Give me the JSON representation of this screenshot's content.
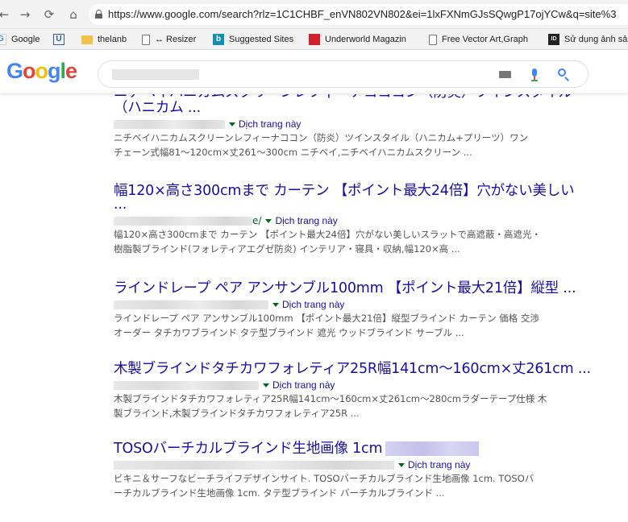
{
  "browser": {
    "url": "https://www.google.com/search?rlz=1C1CHBF_enVN802VN802&ei=1lxFXNmGJsSQwgP17ojYCw&q=site%3",
    "bookmarks": [
      {
        "label": "Google",
        "icon": "google-icon"
      },
      {
        "label": "",
        "icon": "u-icon"
      },
      {
        "label": "thelanb",
        "icon": "folder-icon"
      },
      {
        "label": "↔ Resizer",
        "icon": "page-icon"
      },
      {
        "label": "Suggested Sites",
        "icon": "bing-icon"
      },
      {
        "label": "Underworld Magazin",
        "icon": "red-square-icon"
      },
      {
        "label": "Free Vector Art,Graph",
        "icon": "page-icon"
      },
      {
        "label": "Sử dụng ảnh sả",
        "icon": "black-square-icon"
      }
    ]
  },
  "google": {
    "logo": [
      "G",
      "o",
      "o",
      "g",
      "l",
      "e"
    ],
    "logo_colors": [
      "#4285f4",
      "#ea4335",
      "#fbbc05",
      "#4285f4",
      "#34a853",
      "#ea4335"
    ]
  },
  "results": [
    {
      "title_line1": "ニチベイハニカムスクリーンレフィーナコココン（防炎）ツインスタイル",
      "title_line2": "（ハニカム ...",
      "cite_tail": "",
      "translate": "Dịch trang này",
      "snippet_line1": "ニチベイハニカムスクリーンレフィーナココン（防炎）ツインスタイル（ハニカム+プリーツ）ワン",
      "snippet_line2": "チェーン式幅81～120cm×丈261～300cm ニチベイ,ニチベイハニカムスクリーン ..."
    },
    {
      "title_line1": "幅120×高さ300cmまで カーテン 【ポイント最大24倍】穴がない美しい",
      "title_line2": "...",
      "cite_tail": "e/",
      "translate": "Dịch trang này",
      "snippet_line1": "幅120×高さ300cmまで カーテン 【ポイント最大24倍】穴がない美しいスラットで高遮蔽・高遮光・",
      "snippet_line2": "樹脂製ブラインド(フォレティアエグゼ防炎) インテリア・寝具・収納,幅120×高 ..."
    },
    {
      "title_line1": "ラインドレープ ペア アンサンブル100mm 【ポイント最大21倍】縦型 ...",
      "cite_tail": "",
      "translate": "Dịch trang này",
      "snippet_line1": "ラインドレープ ペア アンサンブル100mm 【ポイント最大21倍】縦型ブラインド カーテン 価格 交渉",
      "snippet_line2": "オーダー タチカワブラインド タテ型ブラインド 遮光 ウッドブラインド サーブル ..."
    },
    {
      "title_line1": "木製ブラインドタチカワフォレティア25R幅141cm～160cm×丈261cm ...",
      "cite_tail": "",
      "translate": "Dịch trang này",
      "snippet_line1": "木製ブラインドタチカワフォレティア25R幅141cm～160cm×丈261cm～280cmラダーテープ仕様 木",
      "snippet_line2": "製ブラインド,木製ブラインドタチカワフォレティア25R ..."
    },
    {
      "title_line1": "TOSOバーチカルブラインド生地画像 1cm",
      "cite_tail": "",
      "translate": "Dịch trang này",
      "snippet_line1": "ビキニ＆サーフなビーチライフデザインサイト. TOSOバーチカルブラインド生地画像 1cm. TOSOバ",
      "snippet_line2": "ーチカルブラインド生地画像 1cm. タテ型ブラインド バーチカルブラインド ..."
    }
  ]
}
